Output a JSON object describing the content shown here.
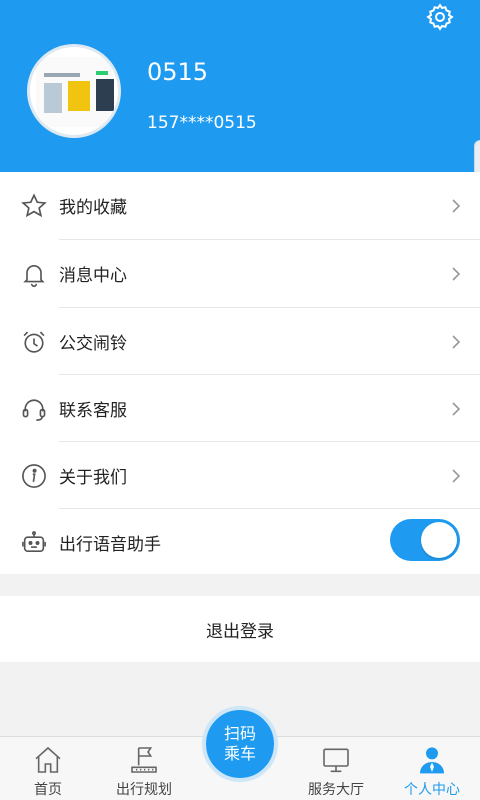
{
  "profile": {
    "username": "0515",
    "phone": "157****0515"
  },
  "menu": [
    {
      "label": "我的收藏",
      "icon": "star-icon"
    },
    {
      "label": "消息中心",
      "icon": "bell-icon"
    },
    {
      "label": "公交闹铃",
      "icon": "alarm-clock-icon"
    },
    {
      "label": "联系客服",
      "icon": "headset-icon"
    },
    {
      "label": "关于我们",
      "icon": "info-icon"
    },
    {
      "label": "出行语音助手",
      "icon": "robot-icon",
      "toggle_on": true
    }
  ],
  "logout_label": "退出登录",
  "tabs": [
    {
      "label": "首页",
      "icon": "home-icon"
    },
    {
      "label": "出行规划",
      "icon": "route-flag-icon"
    },
    {
      "label": "服务大厅",
      "icon": "monitor-icon"
    },
    {
      "label": "个人中心",
      "icon": "person-icon",
      "active": true
    }
  ],
  "scan_button": {
    "line1": "扫码",
    "line2": "乘车"
  },
  "colors": {
    "accent": "#1e9bf0"
  }
}
